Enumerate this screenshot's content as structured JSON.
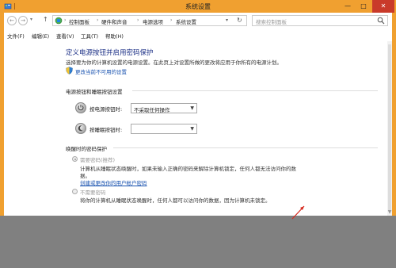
{
  "window": {
    "title": "系统设置",
    "minimize_symbol": "—",
    "maximize_symbol": "□",
    "close_symbol": "✕"
  },
  "navbar": {
    "back_symbol": "←",
    "forward_symbol": "→",
    "dropdown_symbol": "▾",
    "up_symbol": "↑",
    "breadcrumb": [
      "控制面板",
      "硬件和声音",
      "电源选项",
      "系统设置"
    ],
    "breadcrumb_sep": "›",
    "refresh_symbol": "↻",
    "search_placeholder": "搜索控制面板"
  },
  "menu": [
    "文件(F)",
    "编辑(E)",
    "查看(V)",
    "工具(T)",
    "帮助(H)"
  ],
  "page": {
    "heading": "定义电源按钮并启用密码保护",
    "description": "选择要为你的计算机设置的电源设置。在此页上对设置所做的更改将应用于你所有的电源计划。",
    "change_link": "更改当前不可用的设置"
  },
  "power_section": {
    "title": "电源按钮和睡眠按钮设置",
    "power_button_label": "按电源按钮时:",
    "power_button_value": "不采取任何操作",
    "sleep_button_label": "按睡眠按钮时:",
    "sleep_button_value": ""
  },
  "wake_section": {
    "title": "唤醒时的密码保护",
    "require_label": "需要密码(推荐)",
    "require_desc": "计算机从睡眠状态唤醒时，如果未输入正确的密码来解除计算机锁定，任何人都无法访问你的数",
    "require_desc2": "据。",
    "require_link": "创建或更改你的用户帐户密码",
    "norequire_label": "不需要密码",
    "norequire_desc": "将你的计算机从睡眠状态唤醒时，任何人都可以访问你的数据，因为计算机未锁定。"
  },
  "colors": {
    "title_bar": "#f0a030",
    "close_button": "#c93a2a",
    "heading": "#1e3287",
    "link": "#1a53b0"
  }
}
